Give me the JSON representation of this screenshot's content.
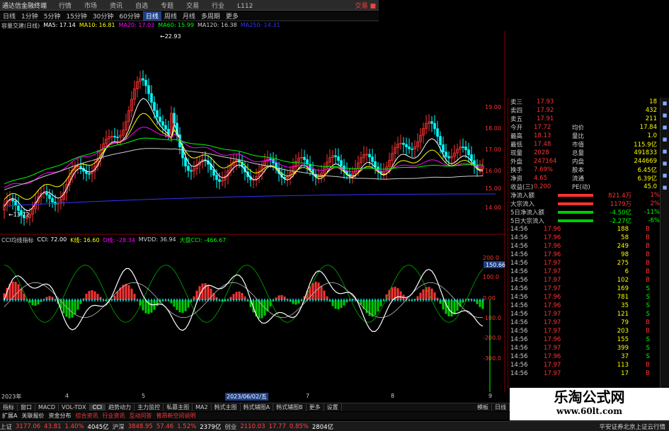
{
  "app_title": "通达信金融终端",
  "menu": [
    "行情",
    "市场",
    "资讯",
    "自选",
    "专题",
    "交易",
    "行业",
    "L112"
  ],
  "title_right": "交易 ■",
  "periods": [
    "日线",
    "1分钟",
    "5分钟",
    "15分钟",
    "30分钟",
    "60分钟",
    "日线",
    "周线",
    "月线",
    "多周期",
    "更多"
  ],
  "selected_period": "日线",
  "ma_legend": [
    {
      "t": "容量交建(日线)",
      "c": "#ccc"
    },
    {
      "t": "MA5: 17.14",
      "c": "#fff"
    },
    {
      "t": "MA10: 16.81",
      "c": "#ff0"
    },
    {
      "t": "MA20: 17.03",
      "c": "#f0f"
    },
    {
      "t": "MA60: 15.99",
      "c": "#0f0"
    },
    {
      "t": "MA120: 16.38",
      "c": "#ccc"
    },
    {
      "t": "MA250: 14.31",
      "c": "#33f"
    }
  ],
  "price_high_label": "←22.93",
  "price_low_label": "←13.72",
  "indicator_legend": [
    {
      "t": "CCI均线指标",
      "c": "#ccc"
    },
    {
      "t": "CCI: 72.00",
      "c": "#fff"
    },
    {
      "t": "K线: 16.60",
      "c": "#ff0"
    },
    {
      "t": "D线: -28.34",
      "c": "#f0f"
    },
    {
      "t": "MVDD: 36.94",
      "c": "#ccc"
    },
    {
      "t": "大盘CCI: -466.67",
      "c": "#0f0"
    }
  ],
  "price_axis": [
    "19.00",
    "18.00",
    "17.00",
    "16.00",
    "15.00",
    "14.00"
  ],
  "ind_axis": [
    "200.0",
    "100.0",
    "0.00",
    "-100.0",
    "-200.0",
    "-300.0"
  ],
  "ind_marker": "150.66",
  "quote_panel": {
    "asks": [
      {
        "label": "卖三",
        "price": "17.93",
        "vol": "18"
      },
      {
        "label": "卖四",
        "price": "17.92",
        "vol": "432"
      },
      {
        "label": "卖五",
        "price": "17.91",
        "vol": "211"
      }
    ],
    "stats": [
      {
        "l1": "今开",
        "v1": "17.72",
        "l2": "均价",
        "v2": "17.84"
      },
      {
        "l1": "最高",
        "v1": "18.13",
        "l2": "量比",
        "v2": "1.0"
      },
      {
        "l1": "最低",
        "v1": "17.48",
        "l2": "市值",
        "v2": "115.9亿"
      },
      {
        "l1": "现量",
        "v1": "2028",
        "l2": "总量",
        "v2": "491833"
      },
      {
        "l1": "外盘",
        "v1": "247164",
        "l2": "内盘",
        "v2": "244669"
      },
      {
        "l1": "换手",
        "v1": "7.69%",
        "l2": "股本",
        "v2": "6.45亿"
      },
      {
        "l1": "净资",
        "v1": "4.65",
        "l2": "流通",
        "v2": "6.39亿"
      },
      {
        "l1": "收益(三)",
        "v1": "0.200",
        "l2": "PE(动)",
        "v2": "45.0"
      }
    ],
    "flows": [
      {
        "label": "净流入额",
        "val": "821.4万",
        "pct": "1%"
      },
      {
        "label": "大宗流入",
        "val": "1179万",
        "pct": "2%"
      },
      {
        "label": "5日净流入额",
        "val": "-4.50亿",
        "pct": "-11%"
      },
      {
        "label": "5日大宗流入",
        "val": "-2.27亿",
        "pct": "-6%"
      }
    ],
    "ticks": [
      {
        "t": "14:56",
        "p": "17.96",
        "v": "188",
        "d": "B"
      },
      {
        "t": "14:56",
        "p": "17.96",
        "v": "58",
        "d": "B"
      },
      {
        "t": "14:56",
        "p": "17.96",
        "v": "249",
        "d": "B"
      },
      {
        "t": "14:56",
        "p": "17.96",
        "v": "98",
        "d": "B"
      },
      {
        "t": "14:56",
        "p": "17.97",
        "v": "275",
        "d": "B"
      },
      {
        "t": "14:56",
        "p": "17.97",
        "v": "6",
        "d": "B"
      },
      {
        "t": "14:56",
        "p": "17.97",
        "v": "102",
        "d": "B"
      },
      {
        "t": "14:56",
        "p": "17.97",
        "v": "169",
        "d": "S"
      },
      {
        "t": "14:56",
        "p": "17.96",
        "v": "781",
        "d": "S"
      },
      {
        "t": "14:56",
        "p": "17.96",
        "v": "35",
        "d": "S"
      },
      {
        "t": "14:56",
        "p": "17.97",
        "v": "121",
        "d": "S"
      },
      {
        "t": "14:56",
        "p": "17.97",
        "v": "79",
        "d": "B"
      },
      {
        "t": "14:56",
        "p": "17.97",
        "v": "203",
        "d": "B"
      },
      {
        "t": "14:56",
        "p": "17.96",
        "v": "155",
        "d": "S"
      },
      {
        "t": "14:56",
        "p": "17.97",
        "v": "399",
        "d": "S"
      },
      {
        "t": "14:56",
        "p": "17.96",
        "v": "37",
        "d": "S"
      },
      {
        "t": "14:56",
        "p": "17.97",
        "v": "113",
        "d": "B"
      },
      {
        "t": "14:56",
        "p": "17.97",
        "v": "17",
        "d": "B"
      }
    ]
  },
  "time_axis": [
    "2023年",
    "4",
    "5",
    "2023/06/02/五",
    "7",
    "8",
    "9"
  ],
  "tabs": [
    "指标",
    "窗口",
    "MACD",
    "VOL-TDX",
    "CCI",
    "趋势动力",
    "主力监控",
    "私募主图",
    "MA2",
    "韩式主图",
    "韩式辅图A",
    "韩式辅图B",
    "更多",
    "设置"
  ],
  "selected_tab": "CCI",
  "right_tabs": [
    "模板",
    "日线"
  ],
  "subtabs": [
    "扩展A",
    "关联报价",
    "资金分布",
    "综合资讯",
    "行业资讯",
    "互动问答",
    "普昂新空间说明"
  ],
  "index_bar": [
    {
      "t": "上证",
      "c": "#ccc"
    },
    {
      "t": "3177.06",
      "c": "#f44"
    },
    {
      "t": "43.81",
      "c": "#f44"
    },
    {
      "t": "1.40%",
      "c": "#f44"
    },
    {
      "t": "4045亿",
      "c": "#fff"
    },
    {
      "t": "沪深",
      "c": "#ccc"
    },
    {
      "t": "3848.95",
      "c": "#f44"
    },
    {
      "t": "57.46",
      "c": "#f44"
    },
    {
      "t": "1.52%",
      "c": "#f44"
    },
    {
      "t": "2379亿",
      "c": "#fff"
    },
    {
      "t": "创业",
      "c": "#ccc"
    },
    {
      "t": "2110.03",
      "c": "#f44"
    },
    {
      "t": "17.77",
      "c": "#f44"
    },
    {
      "t": "0.85%",
      "c": "#f44"
    },
    {
      "t": "2804亿",
      "c": "#fff"
    },
    {
      "t": "平安证券北京上证云行情",
      "c": "#ccc"
    }
  ],
  "watermark": {
    "title": "乐淘公式网",
    "url": "www.60lt.com"
  },
  "colors": {
    "up": "#ff3333",
    "down": "#00ffff",
    "ma5": "#ffffff",
    "ma10": "#ffff00",
    "ma20": "#ff00ff",
    "ma60": "#00ff00",
    "ma120": "#cccccc",
    "ma250": "#3333ff"
  }
}
